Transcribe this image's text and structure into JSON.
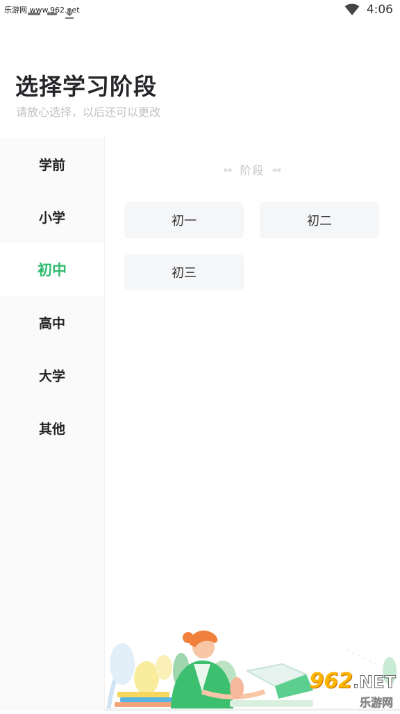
{
  "status_bar": {
    "watermark": "乐游网 www.962.net",
    "time": "4:06"
  },
  "header": {
    "title": "选择学习阶段",
    "subtitle": "请放心选择，以后还可以更改"
  },
  "nav": {
    "items": [
      {
        "label": "学前"
      },
      {
        "label": "小学"
      },
      {
        "label": "初中"
      },
      {
        "label": "高中"
      },
      {
        "label": "大学"
      },
      {
        "label": "其他"
      }
    ],
    "active_index": 2
  },
  "content": {
    "section_title": "阶段",
    "grades": [
      {
        "label": "初一"
      },
      {
        "label": "初二"
      },
      {
        "label": "初三"
      }
    ]
  },
  "watermark_logo": {
    "number": "962",
    "domain": ".NET",
    "name": "乐游网"
  },
  "colors": {
    "accent": "#2dbb6d",
    "nav_bg": "#fafafa",
    "button_bg": "#f5f6f8"
  }
}
